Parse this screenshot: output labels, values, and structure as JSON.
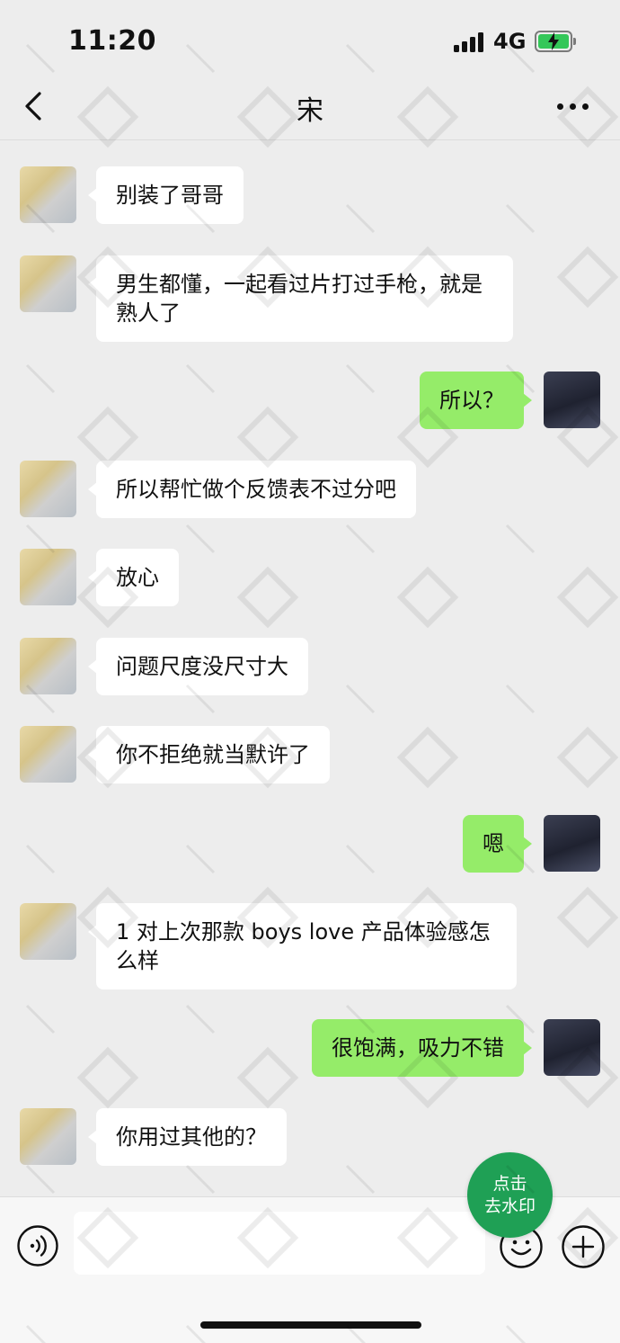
{
  "status_bar": {
    "time": "11:20",
    "network": "4G",
    "battery": "charging"
  },
  "header": {
    "back_icon": "chevron-left-icon",
    "title": "宋",
    "more_icon": "ellipsis-icon"
  },
  "messages": [
    {
      "from": "them",
      "text": "别装了哥哥"
    },
    {
      "from": "them",
      "text": "男生都懂，一起看过片打过手枪，就是熟人了"
    },
    {
      "from": "me",
      "text": "所以？"
    },
    {
      "from": "them",
      "text": "所以帮忙做个反馈表不过分吧"
    },
    {
      "from": "them",
      "text": "放心"
    },
    {
      "from": "them",
      "text": "问题尺度没尺寸大"
    },
    {
      "from": "them",
      "text": "你不拒绝就当默许了"
    },
    {
      "from": "me",
      "text": "嗯"
    },
    {
      "from": "them",
      "text": "1 对上次那款 boys love 产品体验感怎么样"
    },
    {
      "from": "me",
      "text": "很饱满，吸力不错"
    },
    {
      "from": "them",
      "text": "你用过其他的？"
    }
  ],
  "badge": {
    "line1": "点击",
    "line2": "去水印"
  },
  "input_bar": {
    "voice_icon": "voice-icon",
    "input_value": "",
    "emoji_icon": "emoji-icon",
    "plus_icon": "plus-circle-icon"
  },
  "colors": {
    "background": "#ededed",
    "outgoing_bubble": "#95ec69",
    "incoming_bubble": "#ffffff",
    "badge": "#1fa055",
    "battery": "#34c759"
  }
}
